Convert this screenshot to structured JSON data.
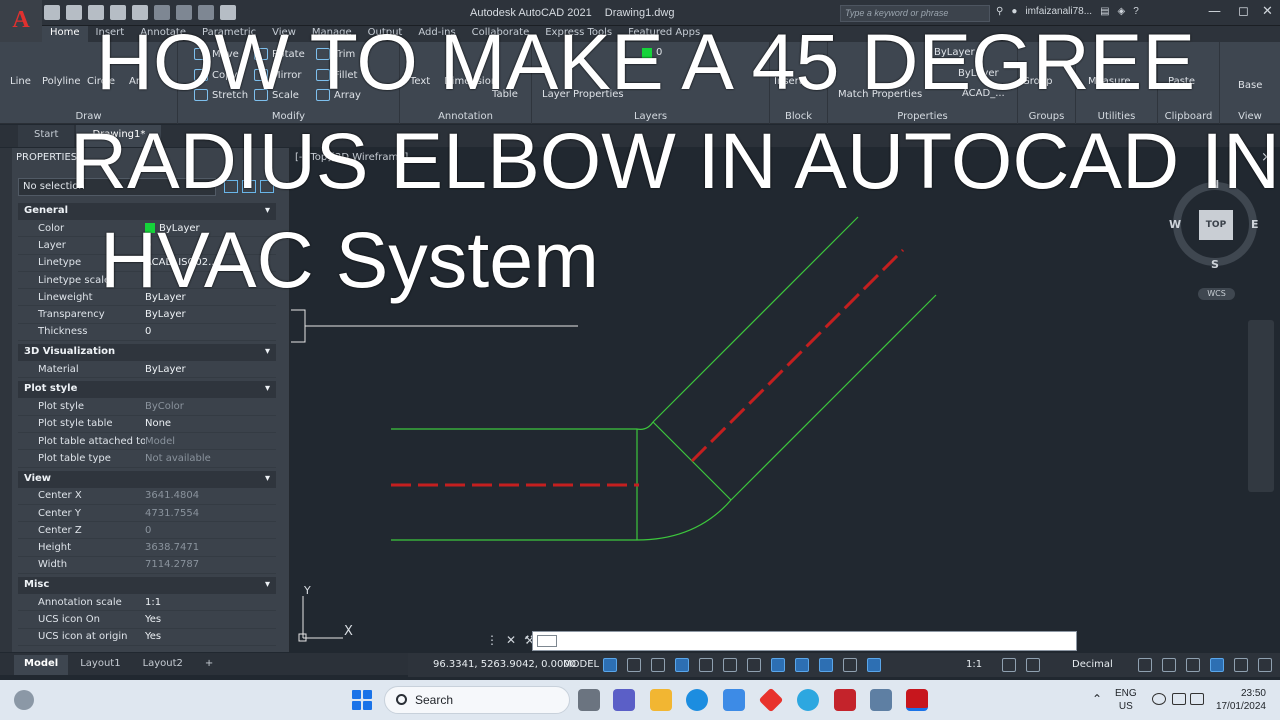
{
  "overlay": {
    "line1": "HOW TO MAKE A 45 DEGREE",
    "line2": "RADIUS ELBOW IN AUTOCAD IN",
    "line3": "HVAC System"
  },
  "titlebar": {
    "logo": "A",
    "app_name": "Autodesk AutoCAD 2021",
    "document": "Drawing1.dwg",
    "search_placeholder": "Type a keyword or phrase",
    "user": "imfaizanali78...",
    "help": "?"
  },
  "ribbon": {
    "tabs": [
      "Home",
      "Insert",
      "Annotate",
      "Parametric",
      "View",
      "Manage",
      "Output",
      "Add-ins",
      "Collaborate",
      "Express Tools",
      "Featured Apps"
    ],
    "draw": {
      "title": "Draw",
      "line": "Line",
      "polyline": "Polyline",
      "circle": "Circle",
      "arc": "Arc"
    },
    "modify": {
      "title": "Modify",
      "move": "Move",
      "rotate": "Rotate",
      "trim": "Trim",
      "copy": "Copy",
      "mirror": "Mirror",
      "fillet": "Fillet",
      "stretch": "Stretch",
      "scale": "Scale",
      "array": "Array"
    },
    "annotation": {
      "title": "Annotation",
      "text": "Text",
      "dimension": "Dimension",
      "table": "Table"
    },
    "layers": {
      "title": "Layers",
      "layer_properties": "Layer Properties",
      "current_layer": "0"
    },
    "block": {
      "title": "Block",
      "insert": "Insert"
    },
    "properties": {
      "title": "Properties",
      "match": "Match Properties",
      "color": "ByLayer",
      "lineweight": "ByLayer",
      "linetype": "ACAD_..."
    },
    "groups": {
      "title": "Groups",
      "group": "Group"
    },
    "utilities": {
      "title": "Utilities",
      "measure": "Measure"
    },
    "clipboard": {
      "title": "Clipboard",
      "paste": "Paste"
    },
    "view": {
      "title": "View",
      "base": "Base"
    }
  },
  "file_tabs": {
    "start": "Start",
    "drawing": "Drawing1*"
  },
  "properties": {
    "title": "PROPERTIES",
    "selection": "No selection",
    "categories": {
      "general": "General",
      "viz": "3D Visualization",
      "plot": "Plot style",
      "view": "View",
      "misc": "Misc"
    },
    "general": [
      {
        "k": "Color",
        "v": "ByLayer"
      },
      {
        "k": "Layer",
        "v": "0"
      },
      {
        "k": "Linetype",
        "v": "ACAD_ISO02..."
      },
      {
        "k": "Linetype scale",
        "v": "5"
      },
      {
        "k": "Lineweight",
        "v": "ByLayer"
      },
      {
        "k": "Transparency",
        "v": "ByLayer"
      },
      {
        "k": "Thickness",
        "v": "0"
      }
    ],
    "viz": [
      {
        "k": "Material",
        "v": "ByLayer"
      }
    ],
    "plot": [
      {
        "k": "Plot style",
        "v": "ByColor"
      },
      {
        "k": "Plot style table",
        "v": "None"
      },
      {
        "k": "Plot table attached to",
        "v": "Model"
      },
      {
        "k": "Plot table type",
        "v": "Not available"
      }
    ],
    "view": [
      {
        "k": "Center X",
        "v": "3641.4804"
      },
      {
        "k": "Center Y",
        "v": "4731.7554"
      },
      {
        "k": "Center Z",
        "v": "0"
      },
      {
        "k": "Height",
        "v": "3638.7471"
      },
      {
        "k": "Width",
        "v": "7114.2787"
      }
    ],
    "misc": [
      {
        "k": "Annotation scale",
        "v": "1:1"
      },
      {
        "k": "UCS icon On",
        "v": "Yes"
      },
      {
        "k": "UCS icon at origin",
        "v": "Yes"
      }
    ]
  },
  "viewport": {
    "label": "[-][Top][2D Wireframe]",
    "close": "×",
    "compass": {
      "n": "N",
      "s": "S",
      "e": "E",
      "w": "W",
      "top": "TOP"
    },
    "wcs": "WCS",
    "ucs_x": "X",
    "ucs_y": "Y",
    "colors": {
      "duct": "#3cc63c",
      "centerline": "#c41f1f",
      "crosshair": "#e6e6e6"
    }
  },
  "layout_tabs": {
    "model": "Model",
    "layout1": "Layout1",
    "layout2": "Layout2",
    "add": "+"
  },
  "status": {
    "coords": "96.3341, 5263.9042, 0.0000",
    "model": "MODEL",
    "scale": "1:1",
    "units": "Decimal"
  },
  "taskbar": {
    "search": "Search",
    "lang1": "ENG",
    "lang2": "US",
    "time": "23:50",
    "date": "17/01/2024"
  }
}
